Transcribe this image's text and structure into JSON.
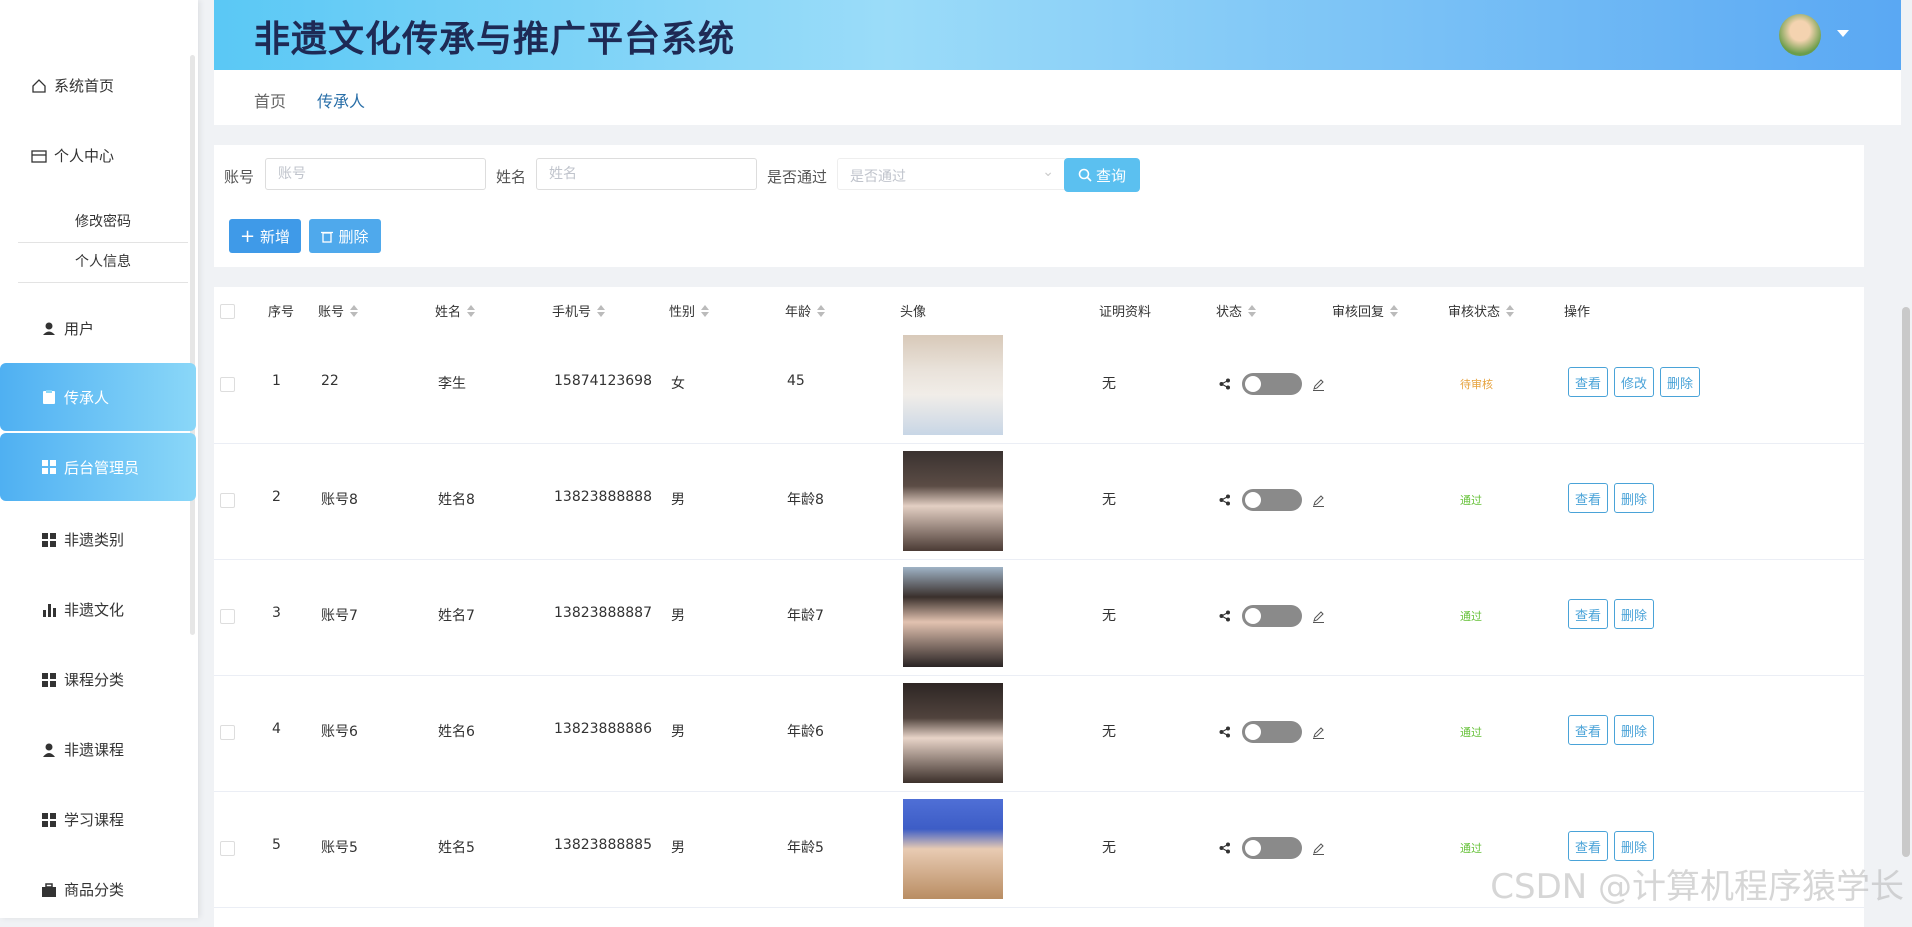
{
  "app": {
    "title": "非遗文化传承与推广平台系统"
  },
  "sidebar": {
    "home": "系统首页",
    "center": "个人中心",
    "sub": [
      "修改密码",
      "个人信息"
    ],
    "items": [
      {
        "label": "用户",
        "icon": "user-icon"
      },
      {
        "label": "传承人",
        "icon": "clipboard-icon",
        "active": true
      },
      {
        "label": "后台管理员",
        "icon": "grid-icon",
        "hover": true
      },
      {
        "label": "非遗类别",
        "icon": "grid-icon"
      },
      {
        "label": "非遗文化",
        "icon": "bar-chart-icon"
      },
      {
        "label": "课程分类",
        "icon": "grid-icon"
      },
      {
        "label": "非遗课程",
        "icon": "person-icon"
      },
      {
        "label": "学习课程",
        "icon": "grid-icon"
      },
      {
        "label": "商品分类",
        "icon": "briefcase-icon"
      }
    ]
  },
  "breadcrumb": {
    "home": "首页",
    "current": "传承人"
  },
  "search": {
    "account_label": "账号",
    "account_placeholder": "账号",
    "name_label": "姓名",
    "name_placeholder": "姓名",
    "passed_label": "是否通过",
    "passed_placeholder": "是否通过",
    "query_button": "查询"
  },
  "actions": {
    "add": "新增",
    "delete": "删除"
  },
  "table": {
    "headers": [
      "序号",
      "账号",
      "姓名",
      "手机号",
      "性别",
      "年龄",
      "头像",
      "证明资料",
      "状态",
      "审核回复",
      "审核状态",
      "操作"
    ],
    "rows": [
      {
        "index": "1",
        "account": "22",
        "name": "李生",
        "phone": "15874123698",
        "gender": "女",
        "age": "45",
        "proof": "无",
        "audit": "待审核",
        "buttons": [
          "查看",
          "修改",
          "删除"
        ]
      },
      {
        "index": "2",
        "account": "账号8",
        "name": "姓名8",
        "phone": "13823888888",
        "gender": "男",
        "age": "年龄8",
        "proof": "无",
        "audit": "通过",
        "buttons": [
          "查看",
          "删除"
        ]
      },
      {
        "index": "3",
        "account": "账号7",
        "name": "姓名7",
        "phone": "13823888887",
        "gender": "男",
        "age": "年龄7",
        "proof": "无",
        "audit": "通过",
        "buttons": [
          "查看",
          "删除"
        ]
      },
      {
        "index": "4",
        "account": "账号6",
        "name": "姓名6",
        "phone": "13823888886",
        "gender": "男",
        "age": "年龄6",
        "proof": "无",
        "audit": "通过",
        "buttons": [
          "查看",
          "删除"
        ]
      },
      {
        "index": "5",
        "account": "账号5",
        "name": "姓名5",
        "phone": "13823888885",
        "gender": "男",
        "age": "年龄5",
        "proof": "无",
        "audit": "通过",
        "buttons": [
          "查看",
          "删除"
        ]
      }
    ]
  },
  "colors": {
    "pending": "#e6a23c",
    "passed": "#67c23a",
    "accent": "#4aa3d8"
  },
  "watermark": "CSDN @计算机程序猿学长"
}
